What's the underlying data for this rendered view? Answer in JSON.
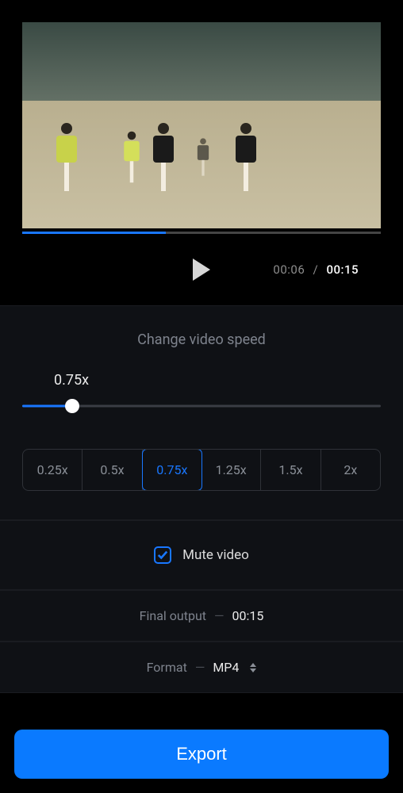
{
  "player": {
    "current_time": "00:06",
    "duration": "00:15",
    "progress_pct": 40
  },
  "speed": {
    "title": "Change video speed",
    "current_label": "0.75x",
    "slider_pct": 14,
    "options": [
      "0.25x",
      "0.5x",
      "0.75x",
      "1.25x",
      "1.5x",
      "2x"
    ],
    "selected_index": 2
  },
  "mute": {
    "label": "Mute video",
    "checked": true
  },
  "output": {
    "label": "Final output",
    "value": "00:15"
  },
  "format": {
    "label": "Format",
    "value": "MP4"
  },
  "export_label": "Export",
  "colors": {
    "accent": "#0a7aff"
  }
}
